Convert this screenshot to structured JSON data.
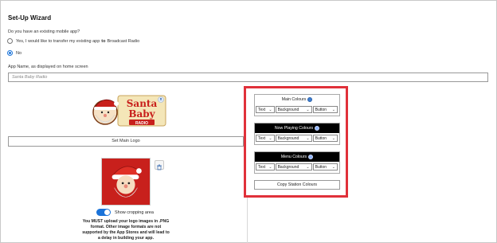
{
  "wizard": {
    "title": "Set-Up Wizard",
    "question": "Do you have an existing mobile app?",
    "option_yes_prefix": "Yes, I would like to transfer my existing app",
    "option_yes_bold": "to",
    "option_yes_suffix": "Broadcast Radio",
    "option_no": "No",
    "selected_option": "No"
  },
  "app_name": {
    "label": "App Name, as displayed on home screen",
    "value": "Santa Baby Radio"
  },
  "logo": {
    "text_line1": "Santa",
    "text_line2": "Baby",
    "text_line3": "RADIO",
    "set_main_logo_label": "Set Main Logo"
  },
  "cropping": {
    "toggle_label": "Show cropping area",
    "toggle_on": true
  },
  "notice": "You MUST upload your logo images in .PNG format. Other image formats are not supported by the App Stores and will lead to a delay in building your app.",
  "colours": {
    "main": {
      "title": "Main Colours",
      "text": "Text",
      "background": "Background",
      "button": "Button"
    },
    "now_playing": {
      "title": "Now Playing Colours",
      "text": "Text",
      "background": "Background",
      "button": "Button"
    },
    "menu": {
      "title": "Menu Colours",
      "text": "Text",
      "background": "Background",
      "button": "Button"
    },
    "copy_label": "Copy Station Colours",
    "highlight_color": "#e0313a",
    "accent_color": "#1a73d9"
  }
}
